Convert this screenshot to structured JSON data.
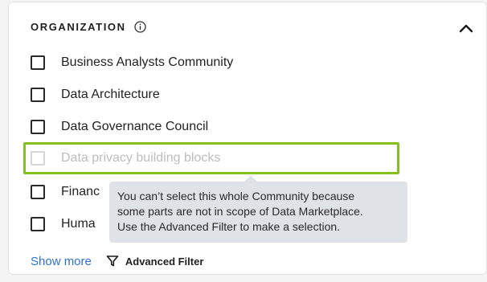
{
  "filter": {
    "title": "ORGANIZATION",
    "info_icon": "info-icon",
    "collapse_icon": "chevron-up-icon",
    "items": [
      {
        "label": "Business Analysts Community",
        "checked": false,
        "disabled": false
      },
      {
        "label": "Data Architecture",
        "checked": false,
        "disabled": false
      },
      {
        "label": "Data Governance Council",
        "checked": false,
        "disabled": false
      },
      {
        "label": "Data privacy building blocks",
        "checked": false,
        "disabled": true
      },
      {
        "label": "Financ",
        "checked": false,
        "disabled": false
      },
      {
        "label": "Huma",
        "checked": false,
        "disabled": false
      }
    ],
    "highlight_color": "#84c11e",
    "tooltip": {
      "line1": "You can’t select this whole Community because",
      "line2": "some parts are not in scope of Data Marketplace.",
      "line3": "Use the Advanced Filter to make a selection."
    },
    "footer": {
      "show_more": "Show more",
      "advanced_filter": "Advanced Filter",
      "advanced_filter_icon": "filter-icon"
    }
  }
}
